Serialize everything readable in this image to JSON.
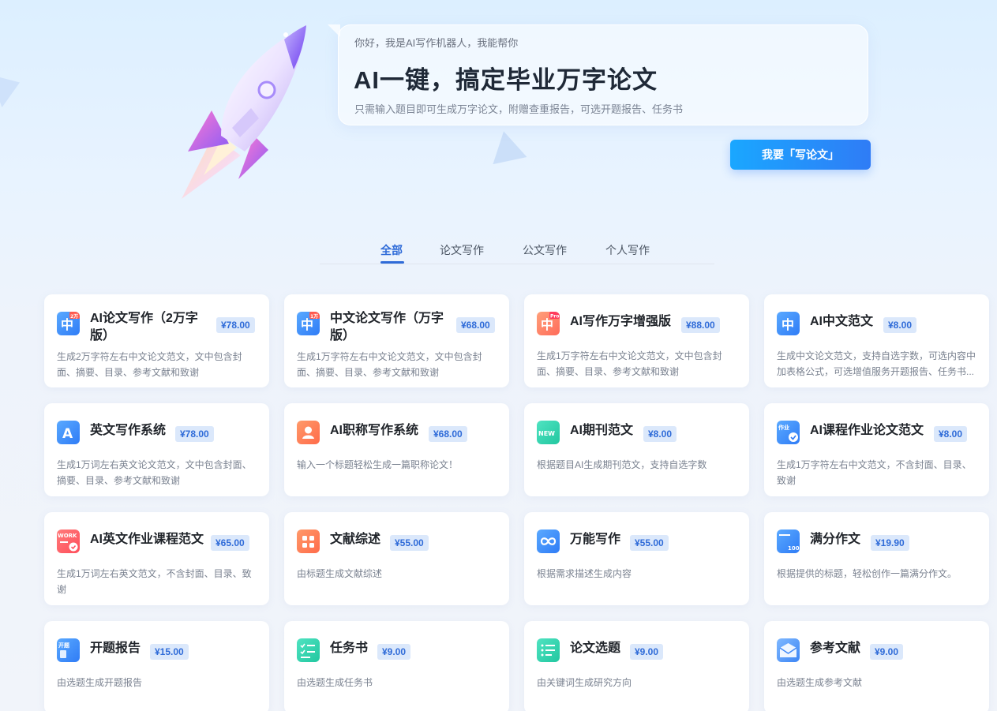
{
  "hero": {
    "greeting": "你好，我是AI写作机器人，我能帮你",
    "title": "AI一键，搞定毕业万字论文",
    "subtitle": "只需输入题目即可生成万字论文，附赠查重报告，可选开题报告、任务书",
    "cta_label": "我要「写论文」"
  },
  "tabs": [
    {
      "label": "全部",
      "active": true
    },
    {
      "label": "论文写作",
      "active": false
    },
    {
      "label": "公文写作",
      "active": false
    },
    {
      "label": "个人写作",
      "active": false
    }
  ],
  "cards": [
    {
      "title": "AI论文写作（2万字版）",
      "price": "¥78.00",
      "desc": "生成2万字符左右中文论文范文，文中包含封面、摘要、目录、参考文献和致谢",
      "icon": "chinese-char-icon",
      "badge": "2万"
    },
    {
      "title": "中文论文写作（万字版）",
      "price": "¥68.00",
      "desc": "生成1万字符左右中文论文范文，文中包含封面、摘要、目录、参考文献和致谢",
      "icon": "chinese-char-icon",
      "badge": "1万"
    },
    {
      "title": "AI写作万字增强版",
      "price": "¥88.00",
      "desc": "生成1万字符左右中文论文范文，文中包含封面、摘要、目录、参考文献和致谢",
      "icon": "chinese-pro-icon",
      "badge": "Pro"
    },
    {
      "title": "AI中文范文",
      "price": "¥8.00",
      "desc": "生成中文论文范文，支持自选字数，可选内容中加表格公式，可选增值服务开题报告、任务书...",
      "icon": "chinese-char-icon",
      "badge": ""
    },
    {
      "title": "英文写作系统",
      "price": "¥78.00",
      "desc": "生成1万词左右英文论文范文，文中包含封面、摘要、目录、参考文献和致谢",
      "icon": "letter-a-icon",
      "badge": ""
    },
    {
      "title": "AI职称写作系统",
      "price": "¥68.00",
      "desc": "输入一个标题轻松生成一篇职称论文！",
      "icon": "person-icon",
      "badge": ""
    },
    {
      "title": "AI期刊范文",
      "price": "¥8.00",
      "desc": "根据题目AI生成期刊范文，支持自选字数",
      "icon": "new-journal-icon",
      "badge": "NEW"
    },
    {
      "title": "AI课程作业论文范文",
      "price": "¥8.00",
      "desc": "生成1万字符左右中文范文，不含封面、目录、致谢",
      "icon": "homework-check-icon",
      "badge": "作业"
    },
    {
      "title": "AI英文作业课程范文",
      "price": "¥65.00",
      "desc": "生成1万词左右英文范文，不含封面、目录、致谢",
      "icon": "work-icon",
      "badge": "WORK"
    },
    {
      "title": "文献综述",
      "price": "¥55.00",
      "desc": "由标题生成文献综述",
      "icon": "grid-icon",
      "badge": ""
    },
    {
      "title": "万能写作",
      "price": "¥55.00",
      "desc": "根据需求描述生成内容",
      "icon": "infinity-icon",
      "badge": ""
    },
    {
      "title": "满分作文",
      "price": "¥19.90",
      "desc": "根据提供的标题，轻松创作一篇满分作文。",
      "icon": "score-100-icon",
      "badge": "100"
    },
    {
      "title": "开题报告",
      "price": "¥15.00",
      "desc": "由选题生成开题报告",
      "icon": "proposal-icon",
      "badge": "开题"
    },
    {
      "title": "任务书",
      "price": "¥9.00",
      "desc": "由选题生成任务书",
      "icon": "checklist-icon",
      "badge": ""
    },
    {
      "title": "论文选题",
      "price": "¥9.00",
      "desc": "由关键词生成研究方向",
      "icon": "topic-list-icon",
      "badge": ""
    },
    {
      "title": "参考文献",
      "price": "¥9.00",
      "desc": "由选题生成参考文献",
      "icon": "envelope-icon",
      "badge": ""
    }
  ],
  "colors": {
    "accent": "#2f6bd8",
    "price_bg": "#dbe8fb",
    "cta_start": "#1aa7ff",
    "cta_end": "#2f7cf6"
  }
}
